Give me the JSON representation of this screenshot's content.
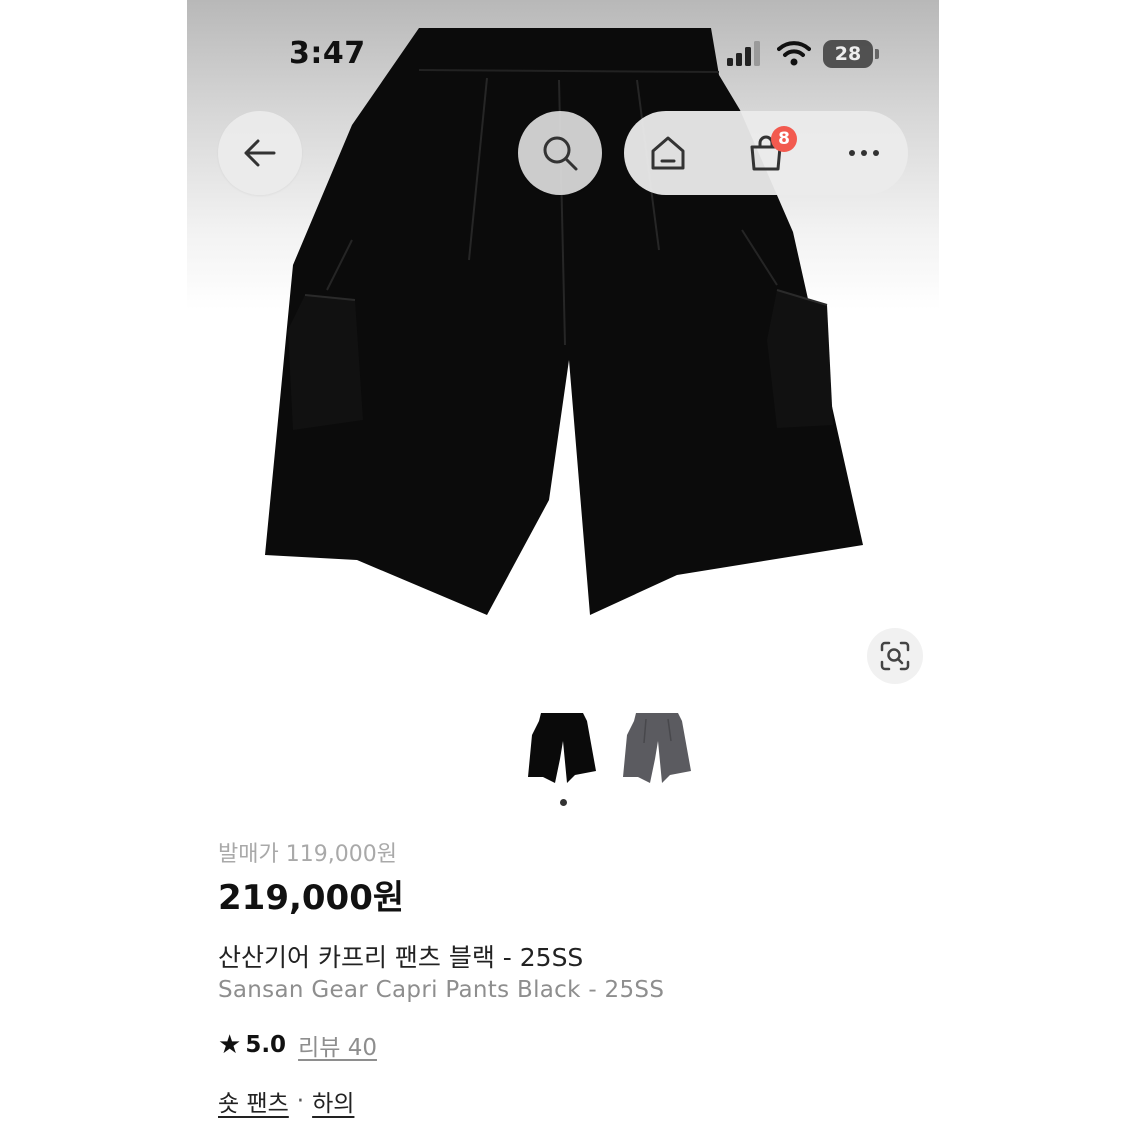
{
  "status_bar": {
    "time": "3:47",
    "battery": "28",
    "icons": [
      "cellular-signal-icon",
      "wifi-icon",
      "battery-icon"
    ]
  },
  "nav": {
    "icons": [
      "back-arrow-icon",
      "search-icon",
      "home-icon",
      "shopping-bag-icon",
      "more-icon"
    ],
    "cart_count": "8"
  },
  "gallery": {
    "icons": [
      "lens-search-icon"
    ],
    "thumbnails": [
      "black",
      "gray"
    ],
    "selected_index": 0
  },
  "product": {
    "original_price": "발매가 119,000원",
    "price": "219,000원",
    "name_ko": "산산기어 카프리 팬츠 블랙 - 25SS",
    "name_en": "Sansan Gear Capri Pants Black - 25SS",
    "rating": "5.0",
    "reviews": "리뷰 40",
    "category_1": "숏 팬츠",
    "category_sep": "·",
    "category_2": "하의"
  },
  "colors": {
    "badge": "#f25a4f",
    "product_black": "#0a0a0a",
    "product_gray": "#5b5b60"
  }
}
